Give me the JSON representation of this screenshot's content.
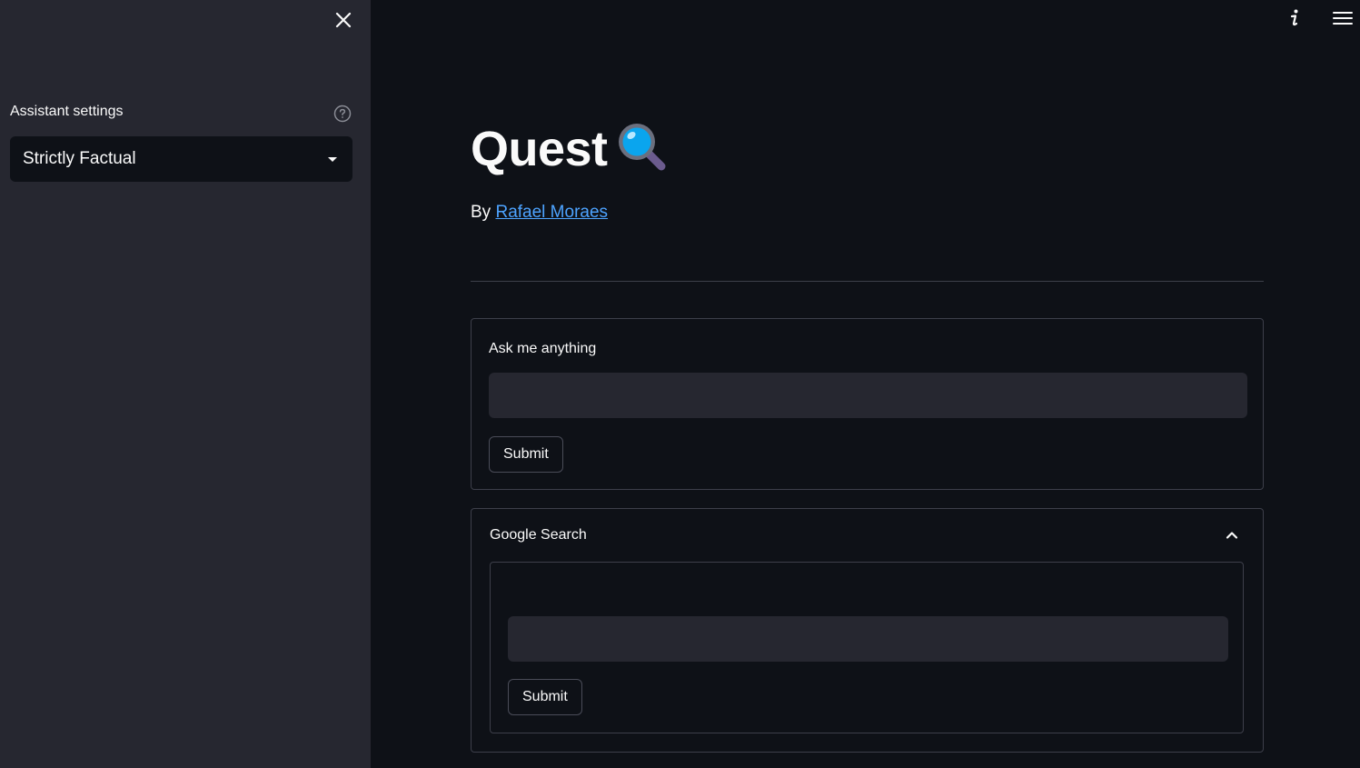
{
  "sidebar": {
    "settings_label": "Assistant settings",
    "select_value": "Strictly Factual"
  },
  "header": {
    "title": "Quest",
    "byline_prefix": "By",
    "author_link": "Rafael Moraes"
  },
  "ask_form": {
    "label": "Ask me anything",
    "input_value": "",
    "submit_label": "Submit"
  },
  "google_search": {
    "title": "Google Search",
    "expanded": true,
    "input_value": "",
    "submit_label": "Submit"
  },
  "colors": {
    "background": "#0e1117",
    "sidebar": "#262730",
    "link": "#4da3ff",
    "input": "#262730"
  },
  "icons": [
    "close-icon",
    "help-icon",
    "caret-down-icon",
    "info-icon",
    "hamburger-menu-icon",
    "magnifier-icon",
    "chevron-up-icon"
  ]
}
